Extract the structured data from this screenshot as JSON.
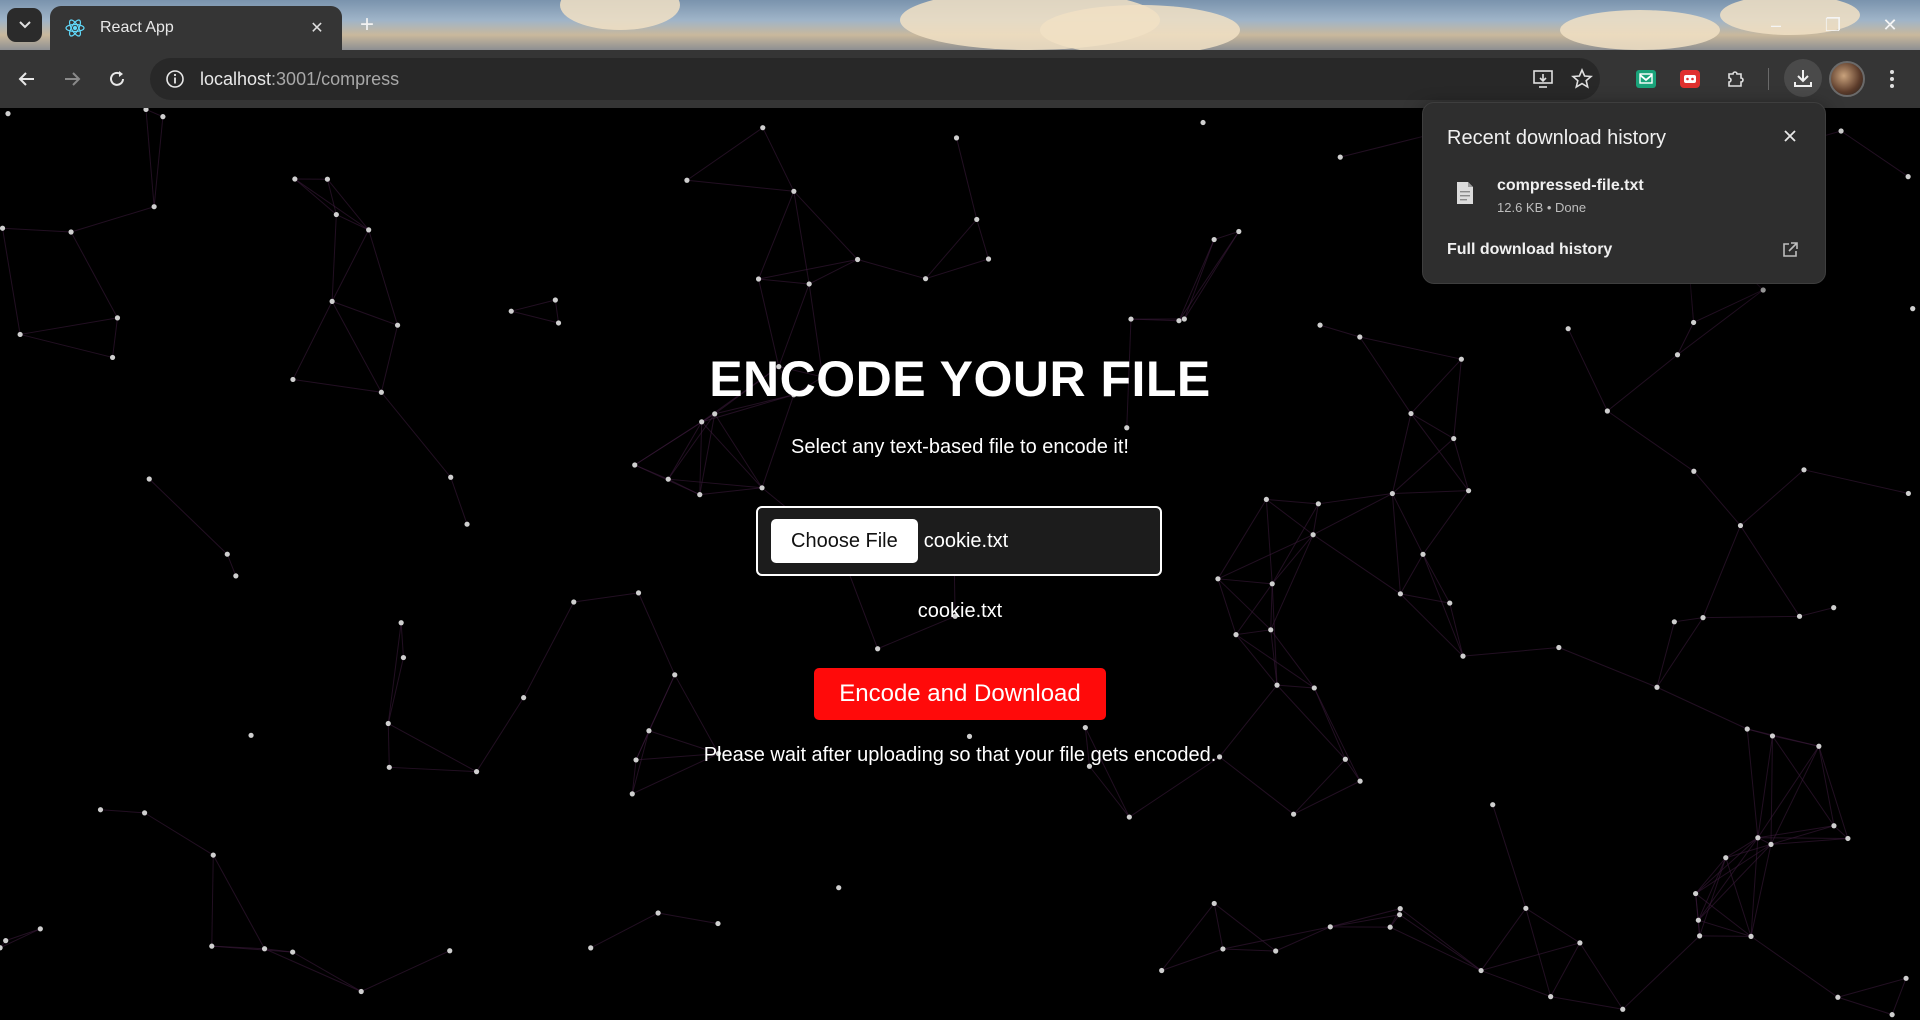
{
  "browser": {
    "tab_title": "React App",
    "url_host": "localhost",
    "url_path": ":3001/compress"
  },
  "page": {
    "heading": "ENCODE YOUR FILE",
    "subtitle": "Select any text-based file to encode it!",
    "choose_file_label": "Choose File",
    "selected_file": "cookie.txt",
    "filename_display": "cookie.txt",
    "encode_button": "Encode and Download",
    "wait_message": "Please wait after uploading so that your file gets encoded."
  },
  "downloads": {
    "title": "Recent download history",
    "item_name": "compressed-file.txt",
    "item_meta": "12.6 KB • Done",
    "full_history": "Full download history"
  },
  "colors": {
    "accent_button": "#ff0a0a",
    "background": "#000000",
    "toolbar": "#353535"
  }
}
